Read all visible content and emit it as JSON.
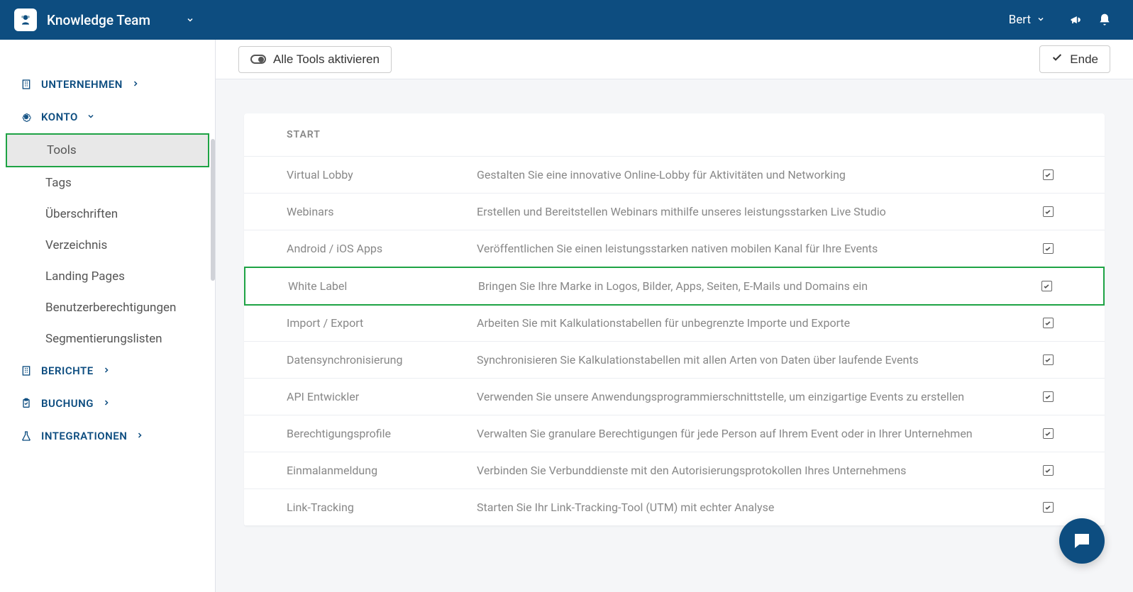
{
  "header": {
    "team_name": "Knowledge Team",
    "user_name": "Bert"
  },
  "sidebar": {
    "sections": [
      {
        "label": "UNTERNEHMEN",
        "icon": "building",
        "expand": "right"
      },
      {
        "label": "KONTO",
        "icon": "gear",
        "expand": "down",
        "children": [
          {
            "label": "Tools",
            "active": true
          },
          {
            "label": "Tags"
          },
          {
            "label": "Überschriften"
          },
          {
            "label": "Verzeichnis"
          },
          {
            "label": "Landing Pages"
          },
          {
            "label": "Benutzerberechtigungen"
          },
          {
            "label": "Segmentierungslisten"
          }
        ]
      },
      {
        "label": "BERICHTE",
        "icon": "building",
        "expand": "right"
      },
      {
        "label": "BUCHUNG",
        "icon": "clipboard",
        "expand": "right"
      },
      {
        "label": "INTEGRATIONEN",
        "icon": "flask",
        "expand": "right"
      }
    ]
  },
  "toolbar": {
    "activate_all": "Alle Tools aktivieren",
    "done": "Ende"
  },
  "panel": {
    "header": "START",
    "rows": [
      {
        "name": "Virtual Lobby",
        "desc": "Gestalten Sie eine innovative Online-Lobby für Aktivitäten und Networking",
        "checked": true
      },
      {
        "name": "Webinars",
        "desc": "Erstellen und Bereitstellen Webinars mithilfe unseres leistungsstarken Live Studio",
        "checked": true
      },
      {
        "name": "Android / iOS Apps",
        "desc": "Veröffentlichen Sie einen leistungsstarken nativen mobilen Kanal für Ihre Events",
        "checked": true
      },
      {
        "name": "White Label",
        "desc": "Bringen Sie Ihre Marke in Logos, Bilder, Apps, Seiten, E-Mails und Domains ein",
        "checked": true,
        "highlight": true
      },
      {
        "name": "Import / Export",
        "desc": "Arbeiten Sie mit Kalkulationstabellen für unbegrenzte Importe und Exporte",
        "checked": true
      },
      {
        "name": "Datensynchronisierung",
        "desc": "Synchronisieren Sie Kalkulationstabellen mit allen Arten von Daten über laufende Events",
        "checked": true
      },
      {
        "name": "API Entwickler",
        "desc": "Verwenden Sie unsere Anwendungsprogrammierschnittstelle, um einzigartige Events zu erstellen",
        "checked": true
      },
      {
        "name": "Berechtigungsprofile",
        "desc": "Verwalten Sie granulare Berechtigungen für jede Person auf Ihrem Event oder in Ihrer Unternehmen",
        "checked": true
      },
      {
        "name": "Einmalanmeldung",
        "desc": "Verbinden Sie Verbunddienste mit den Autorisierungsprotokollen Ihres Unternehmens",
        "checked": true
      },
      {
        "name": "Link-Tracking",
        "desc": "Starten Sie Ihr Link-Tracking-Tool (UTM) mit echter Analyse",
        "checked": true
      }
    ]
  }
}
